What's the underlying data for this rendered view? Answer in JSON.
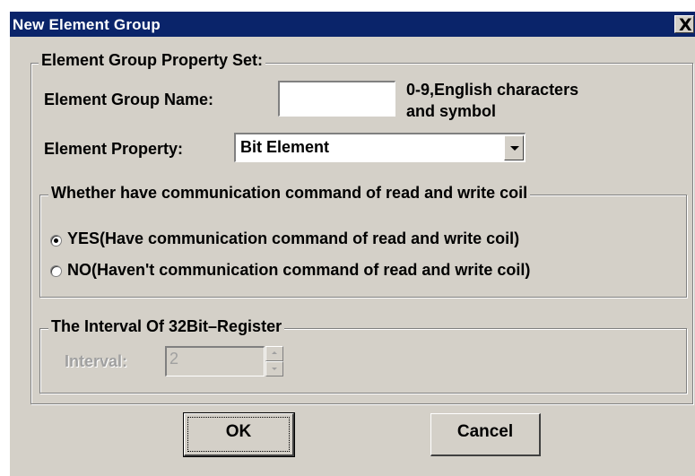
{
  "window": {
    "title": "New Element Group",
    "close_glyph": "X"
  },
  "property_group": {
    "legend": "Element Group Property Set:",
    "name_label": "Element Group Name:",
    "name_value": "",
    "name_hint_line1": "0-9,English characters",
    "name_hint_line2": "and symbol",
    "property_label": "Element Property:",
    "property_selected": "Bit Element"
  },
  "comm_group": {
    "legend": "Whether have communication command of read and write coil",
    "options": [
      {
        "label": "YES(Have communication command of read and write coil)",
        "selected": true
      },
      {
        "label": "NO(Haven't communication command of read and write coil)",
        "selected": false
      }
    ]
  },
  "interval_group": {
    "legend": "The Interval Of 32Bit–Register",
    "interval_label": "Interval:",
    "interval_value": "2",
    "enabled": false
  },
  "buttons": {
    "ok": "OK",
    "cancel": "Cancel"
  },
  "colors": {
    "titlebar": "#0a246a",
    "face": "#d4d0c8",
    "disabled_text": "#a0a0a0"
  }
}
